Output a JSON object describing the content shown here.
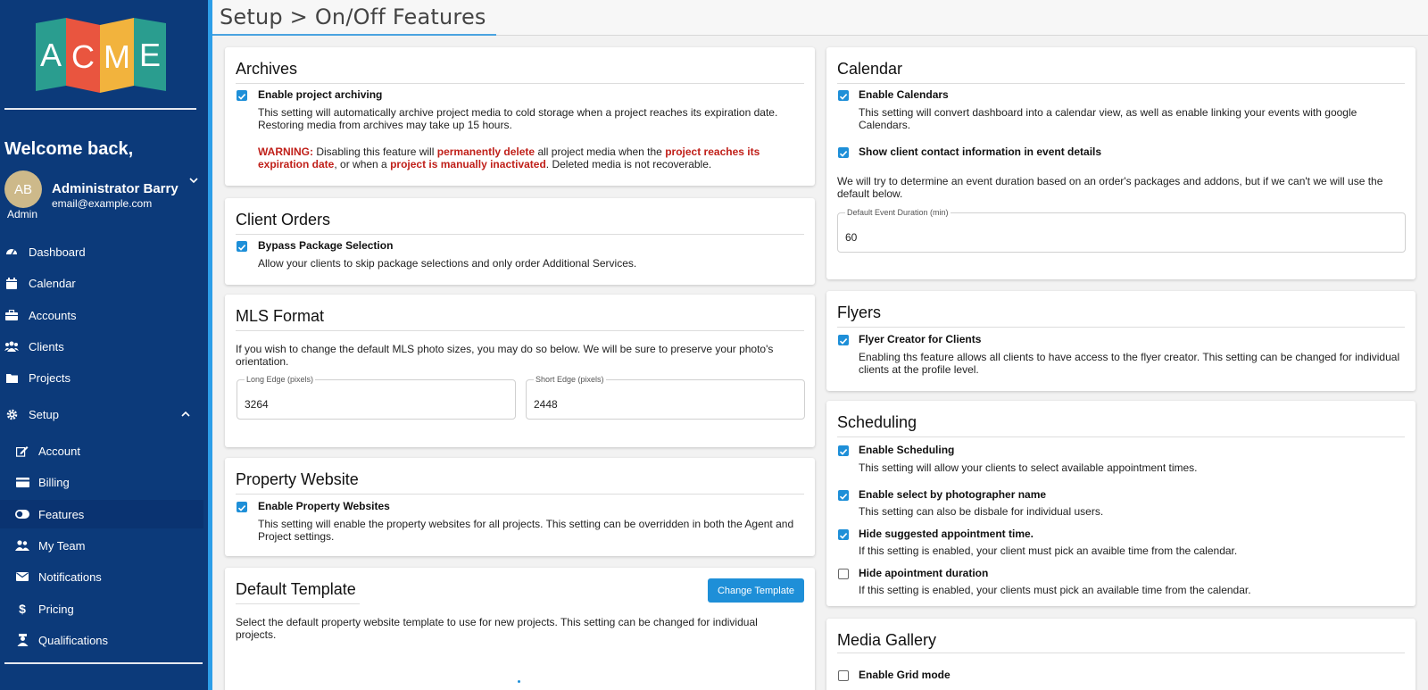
{
  "brand": {
    "logo_text": [
      "A",
      "C",
      "M",
      "E"
    ],
    "logo_colors": [
      "#2a9d8f",
      "#e63946",
      "#f4a261",
      "#2a9d8f"
    ]
  },
  "sidebar": {
    "welcome": "Welcome back,",
    "user": {
      "initials": "AB",
      "name": "Administrator Barry",
      "email": "email@example.com",
      "role": "Admin"
    },
    "items": [
      {
        "label": "Dashboard",
        "icon": "dashboard-icon"
      },
      {
        "label": "Calendar",
        "icon": "calendar-icon"
      },
      {
        "label": "Accounts",
        "icon": "briefcase-icon"
      },
      {
        "label": "Clients",
        "icon": "users-icon"
      },
      {
        "label": "Projects",
        "icon": "folder-icon"
      },
      {
        "label": "Setup",
        "icon": "gear-icon"
      }
    ],
    "sub_items": [
      {
        "label": "Account",
        "icon": "edit-icon"
      },
      {
        "label": "Billing",
        "icon": "credit-card-icon"
      },
      {
        "label": "Features",
        "icon": "toggle-icon",
        "active": true
      },
      {
        "label": "My Team",
        "icon": "team-icon"
      },
      {
        "label": "Notifications",
        "icon": "envelope-icon"
      },
      {
        "label": "Pricing",
        "icon": "dollar-icon"
      },
      {
        "label": "Qualifications",
        "icon": "qualification-icon"
      }
    ]
  },
  "header": {
    "title": "Setup > On/Off Features"
  },
  "archives": {
    "title": "Archives",
    "option": {
      "label": "Enable project archiving",
      "checked": true
    },
    "desc_1": "This setting will automatically archive project media to cold storage when a project reaches its expiration date.",
    "desc_2": "Restoring media from archives may take up 15 hours.",
    "warning": {
      "w1": "WARNING:",
      "t1": " Disabling this feature will ",
      "w2": "permanently delete",
      "t2": " all project media when the ",
      "w3": "project reaches its",
      "w4": "expiration date",
      "t3": ", or when a ",
      "w5": "project is manually inactivated",
      "t4": ". Deleted media is not recoverable."
    }
  },
  "client_orders": {
    "title": "Client Orders",
    "option": {
      "label": "Bypass Package Selection",
      "checked": true
    },
    "desc": "Allow your clients to skip package selections and only order Additional Services."
  },
  "mls": {
    "title": "MLS Format",
    "desc_1": "If you wish to change the default MLS photo sizes, you may do so below. We will be sure to preserve your photo's",
    "desc_2": "orientation.",
    "long_edge": {
      "label": "Long Edge (pixels)",
      "value": "3264"
    },
    "short_edge": {
      "label": "Short Edge (pixels)",
      "value": "2448"
    }
  },
  "property_website": {
    "title": "Property Website",
    "option": {
      "label": "Enable Property Websites",
      "checked": true
    },
    "desc_1": "This setting will enable the property websites for all projects. This setting can be overridden in both the Agent and",
    "desc_2": "Project settings."
  },
  "default_template": {
    "title": "Default Template",
    "button": "Change Template",
    "desc_1": "Select the default property website template to use for new projects. This setting can be changed for individual",
    "desc_2": "projects."
  },
  "calendar": {
    "title": "Calendar",
    "option_1": {
      "label": "Enable Calendars",
      "checked": true
    },
    "desc_1a": "This setting will convert dashboard into a calendar view, as well as enable linking your events with google",
    "desc_1b": "Calendars.",
    "option_2": {
      "label": "Show client contact information in event details",
      "checked": true
    },
    "note_1": "We will try to determine an event duration based on an order's packages and addons, but if we can't we will use the",
    "note_2": "default below.",
    "duration": {
      "label": "Default Event Duration (min)",
      "value": "60"
    }
  },
  "flyers": {
    "title": "Flyers",
    "option": {
      "label": "Flyer Creator for Clients",
      "checked": true
    },
    "desc_1": "Enabling ths feature allows all clients to have access to the flyer creator. This setting can be changed for individual",
    "desc_2": "clients at the profile level."
  },
  "scheduling": {
    "title": "Scheduling",
    "options": [
      {
        "label": "Enable Scheduling",
        "checked": true,
        "desc": "This setting will allow your clients to select available appointment times."
      },
      {
        "label": "Enable select by photographer name",
        "checked": true,
        "desc": "This setting can also be disbale for individual users."
      },
      {
        "label": "Hide suggested appointment time.",
        "checked": true,
        "desc": "If this setting is enabled, your client must pick an avaible time from the calendar."
      },
      {
        "label": "Hide apointment duration",
        "checked": false,
        "desc": "If this setting is enabled, your clients must pick an available time from the calendar."
      }
    ]
  },
  "media_gallery": {
    "title": "Media Gallery",
    "option": {
      "label": "Enable Grid mode",
      "checked": false
    }
  }
}
